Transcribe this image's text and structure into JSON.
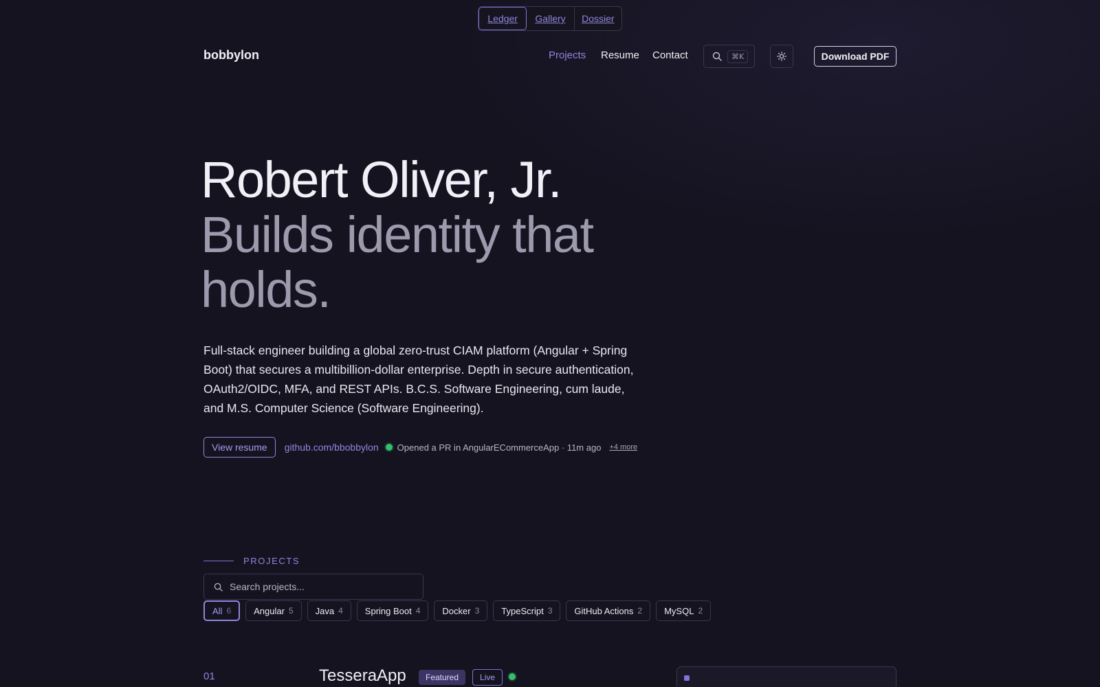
{
  "layout_switch": {
    "options": [
      "Ledger",
      "Gallery",
      "Dossier"
    ],
    "selected": "Ledger"
  },
  "header": {
    "brand": "bobbylon",
    "nav": [
      {
        "label": "Projects",
        "active": true
      },
      {
        "label": "Resume",
        "active": false
      },
      {
        "label": "Contact",
        "active": false
      }
    ],
    "search_shortcut": "⌘K",
    "search_icon": "search-icon",
    "theme_icon": "sun-icon",
    "download_label": "Download PDF"
  },
  "hero": {
    "name": "Robert Oliver, Jr.",
    "tagline_line1": "Builds identity that",
    "tagline_line2": "holds.",
    "bio": "Full-stack engineer building a global zero-trust CIAM platform (Angular + Spring Boot) that secures a multibillion-dollar enterprise. Depth in secure authentication, OAuth2/OIDC, MFA, and REST APIs. B.C.S. Software Engineering, cum laude, and M.S. Computer Science (Software Engineering).",
    "view_resume": "View resume",
    "github": "github.com/bbobbylon",
    "activity": "Opened a PR in AngularECommerceApp · 11m ago",
    "more": "+4 more"
  },
  "projects": {
    "section_label": "PROJECTS",
    "search_placeholder": "Search projects...",
    "filters": [
      {
        "label": "All",
        "count": "6",
        "active": true
      },
      {
        "label": "Angular",
        "count": "5"
      },
      {
        "label": "Java",
        "count": "4"
      },
      {
        "label": "Spring Boot",
        "count": "4"
      },
      {
        "label": "Docker",
        "count": "3"
      },
      {
        "label": "TypeScript",
        "count": "3"
      },
      {
        "label": "GitHub Actions",
        "count": "2"
      },
      {
        "label": "MySQL",
        "count": "2"
      }
    ],
    "first": {
      "number": "01",
      "title": "TesseraApp",
      "featured": "Featured",
      "status": "Live"
    }
  },
  "colors": {
    "accent": "#8f87de",
    "background": "#151320",
    "live": "#34c06a"
  }
}
